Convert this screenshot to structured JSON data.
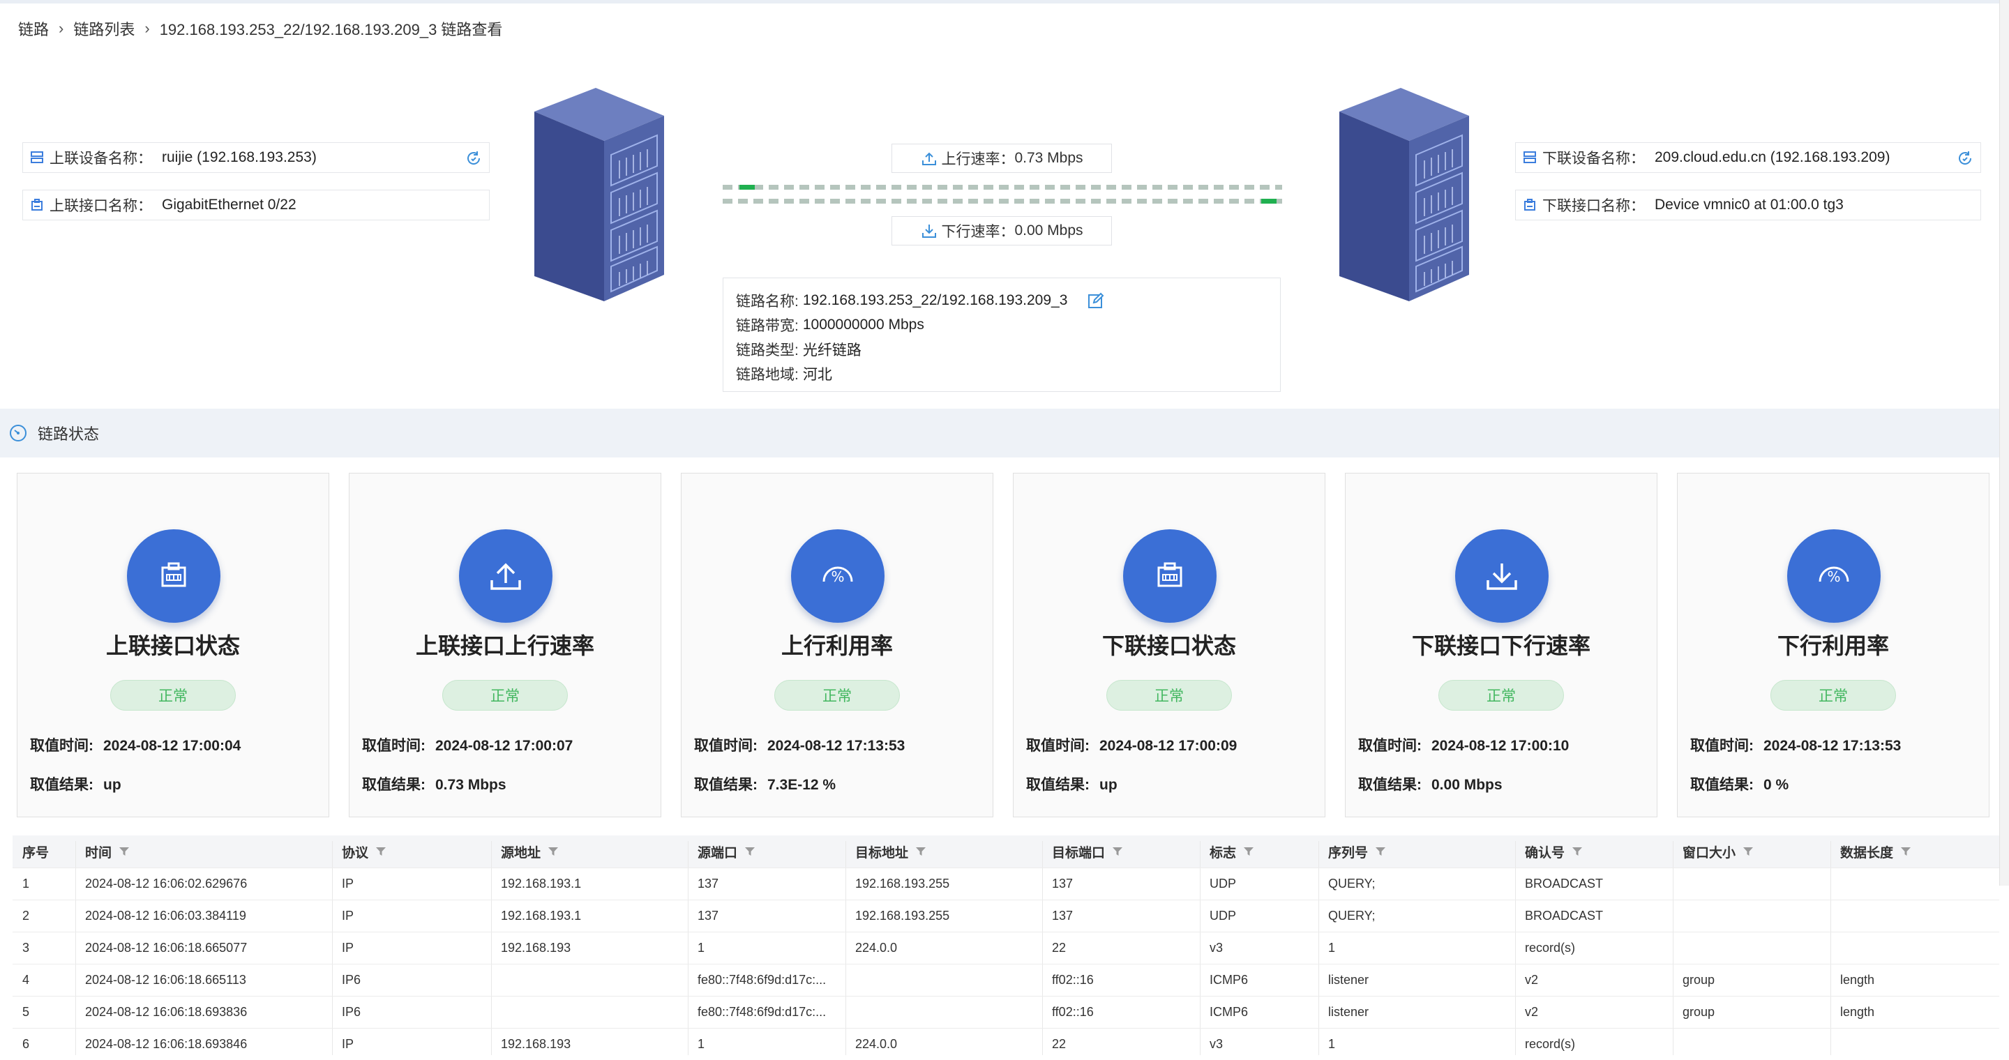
{
  "breadcrumb": {
    "items": [
      "链路",
      "链路列表",
      "192.168.193.253_22/192.168.193.209_3 链路查看"
    ]
  },
  "uplink": {
    "device_label": "上联设备名称：",
    "device_value": "ruijie (192.168.193.253)",
    "port_label": "上联接口名称：",
    "port_value": "GigabitEthernet 0/22"
  },
  "downlink": {
    "device_label": "下联设备名称：",
    "device_value": "209.cloud.edu.cn (192.168.193.209)",
    "port_label": "下联接口名称：",
    "port_value": "Device vmnic0 at 01:00.0 tg3"
  },
  "rates": {
    "up_label": "上行速率：",
    "up_value": "0.73 Mbps",
    "down_label": "下行速率：",
    "down_value": "0.00 Mbps"
  },
  "link_info": {
    "name_label": "链路名称:",
    "name_value": "192.168.193.253_22/192.168.193.209_3",
    "bandwidth_label": "链路带宽:",
    "bandwidth_value": "1000000000 Mbps",
    "type_label": "链路类型:",
    "type_value": "光纤链路",
    "region_label": "链路地域:",
    "region_value": "河北"
  },
  "status_section": {
    "title": "链路状态"
  },
  "cards": [
    {
      "icon": "port-icon",
      "title": "上联接口状态",
      "status": "正常",
      "time_label": "取值时间:",
      "time_value": "2024-08-12 17:00:04",
      "result_label": "取值结果:",
      "result_value": "up"
    },
    {
      "icon": "upload-icon",
      "title": "上联接口上行速率",
      "status": "正常",
      "time_label": "取值时间:",
      "time_value": "2024-08-12 17:00:07",
      "result_label": "取值结果:",
      "result_value": "0.73 Mbps"
    },
    {
      "icon": "percent-gauge-icon",
      "title": "上行利用率",
      "status": "正常",
      "time_label": "取值时间:",
      "time_value": "2024-08-12 17:13:53",
      "result_label": "取值结果:",
      "result_value": "7.3E-12 %"
    },
    {
      "icon": "port-icon",
      "title": "下联接口状态",
      "status": "正常",
      "time_label": "取值时间:",
      "time_value": "2024-08-12 17:00:09",
      "result_label": "取值结果:",
      "result_value": "up"
    },
    {
      "icon": "download-icon",
      "title": "下联接口下行速率",
      "status": "正常",
      "time_label": "取值时间:",
      "time_value": "2024-08-12 17:00:10",
      "result_label": "取值结果:",
      "result_value": "0.00 Mbps"
    },
    {
      "icon": "percent-gauge-icon",
      "title": "下行利用率",
      "status": "正常",
      "time_label": "取值时间:",
      "time_value": "2024-08-12 17:13:53",
      "result_label": "取值结果:",
      "result_value": "0 %"
    }
  ],
  "table": {
    "columns": [
      "序号",
      "时间",
      "协议",
      "源地址",
      "源端口",
      "目标地址",
      "目标端口",
      "标志",
      "序列号",
      "确认号",
      "窗口大小",
      "数据长度"
    ],
    "rows": [
      [
        "1",
        "2024-08-12 16:06:02.629676",
        "IP",
        "192.168.193.1",
        "137",
        "192.168.193.255",
        "137",
        "UDP",
        "QUERY;",
        "BROADCAST",
        "",
        ""
      ],
      [
        "2",
        "2024-08-12 16:06:03.384119",
        "IP",
        "192.168.193.1",
        "137",
        "192.168.193.255",
        "137",
        "UDP",
        "QUERY;",
        "BROADCAST",
        "",
        ""
      ],
      [
        "3",
        "2024-08-12 16:06:18.665077",
        "IP",
        "192.168.193",
        "1",
        "224.0.0",
        "22",
        "v3",
        "1",
        "record(s)",
        "",
        ""
      ],
      [
        "4",
        "2024-08-12 16:06:18.665113",
        "IP6",
        "",
        "fe80::7f48:6f9d:d17c:...",
        "",
        "ff02::16",
        "ICMP6",
        "listener",
        "v2",
        "group",
        "length"
      ],
      [
        "5",
        "2024-08-12 16:06:18.693836",
        "IP6",
        "",
        "fe80::7f48:6f9d:d17c:...",
        "",
        "ff02::16",
        "ICMP6",
        "listener",
        "v2",
        "group",
        "length"
      ],
      [
        "6",
        "2024-08-12 16:06:18.693846",
        "IP",
        "192.168.193",
        "1",
        "224.0.0",
        "22",
        "v3",
        "1",
        "record(s)",
        "",
        ""
      ]
    ]
  },
  "colors": {
    "accent": "#3b6fd6",
    "status_green": "#43b760",
    "link_green": "#20b050"
  }
}
